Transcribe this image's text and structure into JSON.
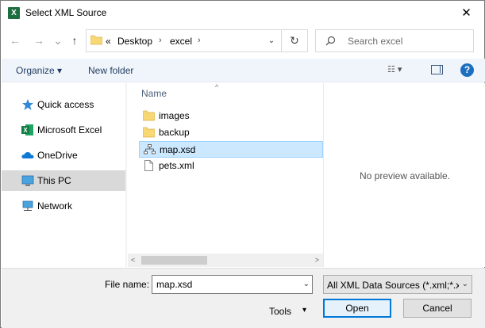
{
  "window": {
    "title": "Select XML Source",
    "app_icon_letter": "X",
    "close_glyph": "✕"
  },
  "nav": {
    "back_glyph": "←",
    "forward_glyph": "→",
    "up_glyph": "↑"
  },
  "address": {
    "overflow": "«",
    "segments": [
      "Desktop",
      "excel"
    ],
    "separator": "›",
    "dropdown_glyph": "⌄",
    "refresh_glyph": "↻"
  },
  "search": {
    "placeholder": "Search excel",
    "icon": "search-icon"
  },
  "toolbar": {
    "organize_label": "Organize ▾",
    "new_folder_label": "New folder",
    "view_glyph": "☷ ▾",
    "help_glyph": "?"
  },
  "sidebar": {
    "items": [
      {
        "label": "Quick access",
        "icon": "star-icon",
        "selected": false
      },
      {
        "label": "Microsoft Excel",
        "icon": "excel-icon",
        "selected": false
      },
      {
        "label": "OneDrive",
        "icon": "cloud-icon",
        "selected": false
      },
      {
        "label": "This PC",
        "icon": "computer-icon",
        "selected": true
      },
      {
        "label": "Network",
        "icon": "network-icon",
        "selected": false
      }
    ]
  },
  "file_list": {
    "column_header": "Name",
    "sort_glyph": "^",
    "files": [
      {
        "name": "images",
        "type": "folder",
        "selected": false
      },
      {
        "name": "backup",
        "type": "folder",
        "selected": false
      },
      {
        "name": "map.xsd",
        "type": "xsd",
        "selected": true
      },
      {
        "name": "pets.xml",
        "type": "xml",
        "selected": false
      }
    ],
    "scroll_left_glyph": "<",
    "scroll_right_glyph": ">"
  },
  "preview": {
    "message": "No preview available."
  },
  "footer": {
    "file_name_label": "File name:",
    "file_name_value": "map.xsd",
    "file_type_value": "All XML Data Sources (*.xml;*.x",
    "tools_label": "Tools",
    "open_label": "Open",
    "cancel_label": "Cancel",
    "caret": "▾"
  },
  "colors": {
    "accent": "#0078d7",
    "selection": "#cce8ff",
    "folder": "#f8d775",
    "excel_green": "#1d6f42"
  }
}
